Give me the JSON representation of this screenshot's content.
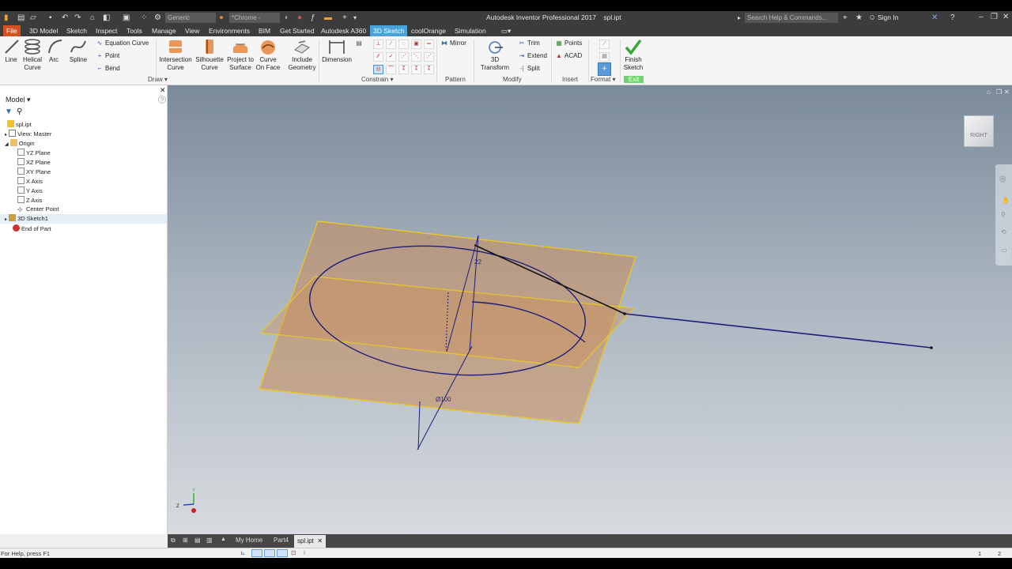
{
  "title": {
    "app": "Autodesk Inventor Professional 2017",
    "file": "spl.ipt"
  },
  "quick_access": {
    "material": "Generic",
    "appearance": "*Chrome -"
  },
  "search": {
    "placeholder": "Search Help & Commands..."
  },
  "signin": {
    "label": "Sign In"
  },
  "menu": [
    "File",
    "3D Model",
    "Sketch",
    "Inspect",
    "Tools",
    "Manage",
    "View",
    "Environments",
    "BIM",
    "Get Started",
    "Autodesk A360",
    "3D Sketch",
    "coolOrange",
    "Simulation"
  ],
  "ribbon": {
    "draw": {
      "line": "Line",
      "helical_1": "Helical",
      "helical_2": "Curve",
      "arc": "Arc",
      "spline": "Spline",
      "equation_curve": "Equation Curve",
      "point": "Point",
      "bend": "Bend",
      "group": "Draw"
    },
    "intersection": {
      "l1": "Intersection",
      "l2": "Curve"
    },
    "silhouette": {
      "l1": "Silhouette",
      "l2": "Curve"
    },
    "project": {
      "l1": "Project to",
      "l2": "Surface"
    },
    "curve_on_face": {
      "l1": "Curve",
      "l2": "On Face"
    },
    "include": {
      "l1": "Include",
      "l2": "Geometry"
    },
    "dimension": "Dimension",
    "constrain_group": "Constrain",
    "mirror": "Mirror",
    "pattern_group": "Pattern",
    "transform": "3D Transform",
    "trim": "Trim",
    "extend": "Extend",
    "split": "Split",
    "modify_group": "Modify",
    "points": "Points",
    "acad": "ACAD",
    "insert_group": "Insert",
    "format_group": "Format",
    "finish": {
      "l1": "Finish",
      "l2": "Sketch"
    },
    "exit_group": "Exit"
  },
  "browser": {
    "header": "Model",
    "items": [
      "spl.ipt",
      "View: Master",
      "Origin",
      "YZ Plane",
      "XZ Plane",
      "XY Plane",
      "X Axis",
      "Y Axis",
      "Z Axis",
      "Center Point",
      "3D Sketch1",
      "End of Part"
    ]
  },
  "viewcube": {
    "face": "RIGHT"
  },
  "dimensions": {
    "height": "22",
    "diameter": "Ø100"
  },
  "triad": {
    "y": "Y",
    "z": "Z"
  },
  "doc_tabs": {
    "home": "My Home",
    "part4": "Part4",
    "current": "spl.ipt"
  },
  "status": {
    "help": "For Help, press F1",
    "n1": "1",
    "n2": "2"
  },
  "colors": {
    "file_tab": "#d2521f",
    "active_tab": "#4aa3d8",
    "plane_edge": "#e8c62a",
    "sketch_line": "#1d1d7a",
    "finish_green": "#3aa63a"
  }
}
